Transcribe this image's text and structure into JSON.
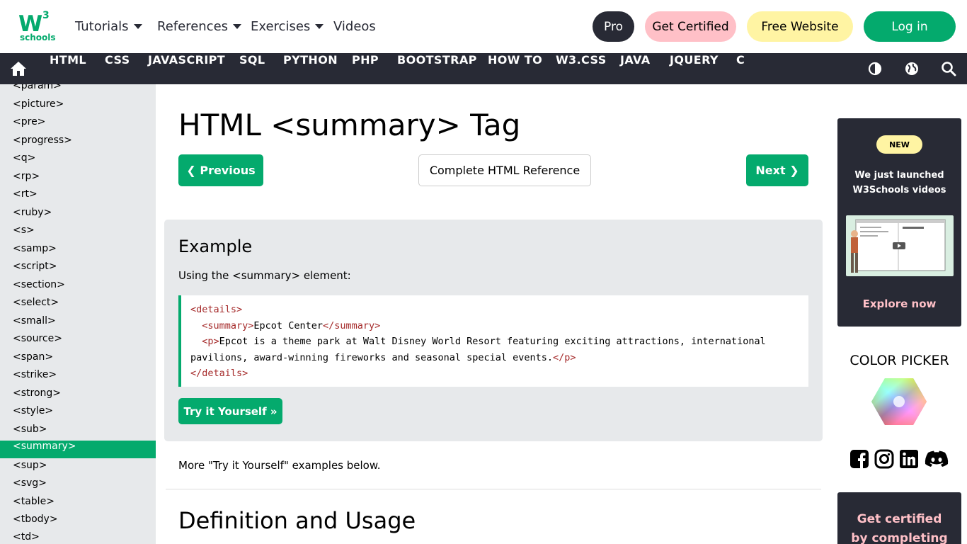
{
  "header": {
    "logo": {
      "w": "W",
      "three": "3",
      "schools": "schools"
    },
    "nav": [
      {
        "label": "Tutorials",
        "dropdown": true
      },
      {
        "label": "References",
        "dropdown": true
      },
      {
        "label": "Exercises",
        "dropdown": true
      },
      {
        "label": "Videos",
        "dropdown": false
      }
    ],
    "buttons": {
      "pro": "Pro",
      "certified": "Get Certified",
      "free_website": "Free Website",
      "login": "Log in"
    }
  },
  "navbar": {
    "items": [
      "HTML",
      "CSS",
      "JAVASCRIPT",
      "SQL",
      "PYTHON",
      "PHP",
      "BOOTSTRAP",
      "HOW TO",
      "W3.CSS",
      "JAVA",
      "JQUERY",
      "C"
    ],
    "icons": [
      "home-icon",
      "contrast-icon",
      "globe-icon",
      "search-icon"
    ]
  },
  "sidebar": {
    "items": [
      "<param>",
      "<picture>",
      "<pre>",
      "<progress>",
      "<q>",
      "<rp>",
      "<rt>",
      "<ruby>",
      "<s>",
      "<samp>",
      "<script>",
      "<section>",
      "<select>",
      "<small>",
      "<source>",
      "<span>",
      "<strike>",
      "<strong>",
      "<style>",
      "<sub>",
      "<summary>",
      "<sup>",
      "<svg>",
      "<table>",
      "<tbody>",
      "<td>"
    ],
    "active": "<summary>"
  },
  "main": {
    "title": "HTML <summary> Tag",
    "prev_label": "❮ Previous",
    "reference_label": "Complete HTML Reference",
    "next_label": "Next ❯",
    "example": {
      "title": "Example",
      "subtitle": "Using the <summary> element:",
      "try_label": "Try it Yourself »"
    },
    "more_text": "More \"Try it Yourself\" examples below.",
    "definition_title": "Definition and Usage"
  },
  "right": {
    "new_badge": "NEW",
    "ad_line1": "We just launched",
    "ad_line2": "W3Schools videos",
    "explore": "Explore now",
    "color_picker": "COLOR PICKER",
    "social_icons": [
      "facebook-icon",
      "instagram-icon",
      "linkedin-icon",
      "discord-icon"
    ],
    "cert_line1": "Get certified",
    "cert_line2": "by completing"
  },
  "colors": {
    "brand_green": "#04AA6D",
    "dark": "#282A35",
    "pink": "#FFC0C7",
    "yellow": "#FFF4A3",
    "sidebar_bg": "#E7E9EB"
  }
}
